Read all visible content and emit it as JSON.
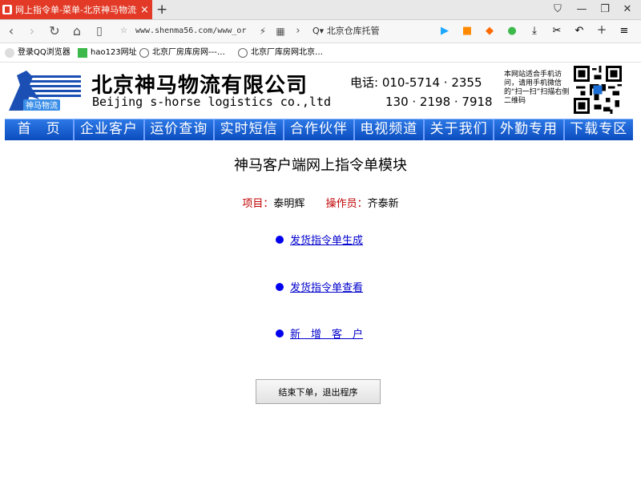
{
  "tab": {
    "title": "网上指令单-菜单-北京神马物流公司",
    "close": "×",
    "new_tab": "+"
  },
  "window": {
    "skin": "⛉",
    "minimize": "—",
    "restore": "❐",
    "close": "✕"
  },
  "nav": {
    "url": "www.shenma56.com/www_or",
    "search_text": "北京仓库托管",
    "search_prefix": "Q▾"
  },
  "bookmarks": [
    {
      "label": "登录QQ浏览器"
    },
    {
      "label": "hao123网址"
    },
    {
      "label": "北京厂房库房网---…"
    },
    {
      "label": "北京厂库房网北京…"
    }
  ],
  "header": {
    "company_name": "北京神马物流有限公司",
    "english_name": "Beijing s-horse logistics co.,ltd",
    "logo_text": "神马物流",
    "phone_line1": "电话: 010-5714 · 2355",
    "phone_line2": "130 · 2198 · 7918",
    "qr_note": "本网站适合手机访问，请用手机微信的“扫一扫”扫描右侧二维码"
  },
  "menu": [
    "首　页",
    "企业客户",
    "运价查询",
    "实时短信",
    "合作伙伴",
    "电视频道",
    "关于我们",
    "外勤专用",
    "下载专区"
  ],
  "main": {
    "title": "神马客户端网上指令单模块",
    "project_label": "项目：",
    "project_value": "泰明辉",
    "operator_label": "操作员：",
    "operator_value": "齐泰新",
    "links": [
      "发货指令单生成",
      "发货指令单查看",
      "新　增　客　户"
    ],
    "exit_button": "结束下单，退出程序"
  },
  "colors": {
    "tab_active": "#e23a26",
    "menu_bg": "#0b4cbe",
    "link": "#0000cc",
    "label_red": "#c00000"
  }
}
